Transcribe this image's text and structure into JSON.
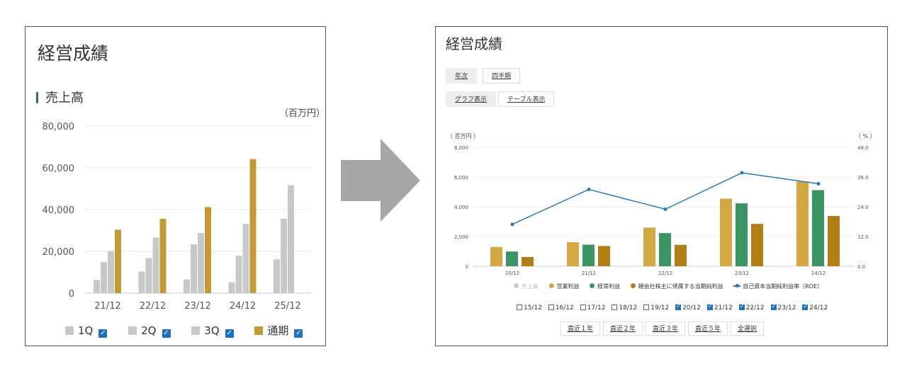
{
  "left": {
    "title": "経営成績",
    "subtitle": "売上高",
    "unit": "（百万円）",
    "legend": [
      {
        "label": "1Q",
        "color": "#c8c8c8",
        "checked": true
      },
      {
        "label": "2Q",
        "color": "#c8c8c8",
        "checked": true
      },
      {
        "label": "3Q",
        "color": "#c8c8c8",
        "checked": true
      },
      {
        "label": "通期",
        "color": "#c49a35",
        "checked": true
      }
    ],
    "check_mark": "✓"
  },
  "right": {
    "title": "経営成績",
    "period_buttons": [
      "年次",
      "四半期"
    ],
    "view_buttons": [
      "グラフ表示",
      "テーブル表示"
    ],
    "unit_left": "（ 百万円 ）",
    "unit_right": "（ % ）",
    "legend": [
      {
        "label": "売上高",
        "color": "#cccccc",
        "muted": true
      },
      {
        "label": "営業利益",
        "color": "#d4a843"
      },
      {
        "label": "経常利益",
        "color": "#3b9464"
      },
      {
        "label": "親会社株主に帰属する当期純利益",
        "color": "#b07e14"
      },
      {
        "label": "自己資本当期純利益率（ROE）",
        "color": "#2a7ab8"
      }
    ],
    "years": [
      {
        "label": "15/12",
        "checked": false
      },
      {
        "label": "16/12",
        "checked": false
      },
      {
        "label": "17/12",
        "checked": false
      },
      {
        "label": "18/12",
        "checked": false
      },
      {
        "label": "19/12",
        "checked": false
      },
      {
        "label": "20/12",
        "checked": true
      },
      {
        "label": "21/12",
        "checked": true
      },
      {
        "label": "22/12",
        "checked": true
      },
      {
        "label": "23/12",
        "checked": true
      },
      {
        "label": "24/12",
        "checked": true
      }
    ],
    "range_buttons": [
      "直近１年",
      "直近２年",
      "直近３年",
      "直近５年",
      "全選択"
    ]
  },
  "chart_data": [
    {
      "type": "bar",
      "title": "売上高",
      "ylabel": "（百万円）",
      "categories": [
        "21/12",
        "22/12",
        "23/12",
        "24/12",
        "25/12"
      ],
      "yticks": [
        "0",
        "20,000",
        "40,000",
        "60,000",
        "80,000"
      ],
      "ylim": [
        0,
        80000
      ],
      "grid": true,
      "series": [
        {
          "name": "1Q",
          "values": [
            6300,
            10400,
            6600,
            5200,
            16200
          ],
          "color": "#c8c8c8"
        },
        {
          "name": "2Q",
          "values": [
            15000,
            16800,
            23400,
            18000,
            35600
          ],
          "color": "#c8c8c8"
        },
        {
          "name": "3Q",
          "values": [
            20200,
            26600,
            28800,
            33200,
            51700
          ],
          "color": "#c8c8c8"
        },
        {
          "name": "通期",
          "values": [
            30400,
            35600,
            41200,
            64200,
            null
          ],
          "color": "#c49a35"
        }
      ]
    },
    {
      "type": "bar",
      "categories": [
        "20/12",
        "21/12",
        "22/12",
        "23/12",
        "24/12"
      ],
      "ylim": [
        0,
        8000
      ],
      "y2lim": [
        0,
        48
      ],
      "yticks": [
        "0",
        "2,000",
        "4,000",
        "6,000",
        "8,000"
      ],
      "y2ticks": [
        "0.0",
        "12.0",
        "24.0",
        "36.0",
        "48.0"
      ],
      "grid": true,
      "series": [
        {
          "name": "営業利益",
          "values": [
            1300,
            1620,
            2600,
            4550,
            5700
          ],
          "color": "#d4a843"
        },
        {
          "name": "経常利益",
          "values": [
            990,
            1450,
            2230,
            4230,
            5120
          ],
          "color": "#3b9464"
        },
        {
          "name": "親会社株主に帰属する当期純利益",
          "values": [
            620,
            1360,
            1440,
            2850,
            3380
          ],
          "color": "#b07e14"
        },
        {
          "name": "自己資本当期純利益率（ROE）",
          "type": "line",
          "axis": "right",
          "values": [
            16.9,
            31.0,
            23.0,
            37.7,
            33.3
          ],
          "color": "#2a7ab8"
        }
      ]
    }
  ]
}
